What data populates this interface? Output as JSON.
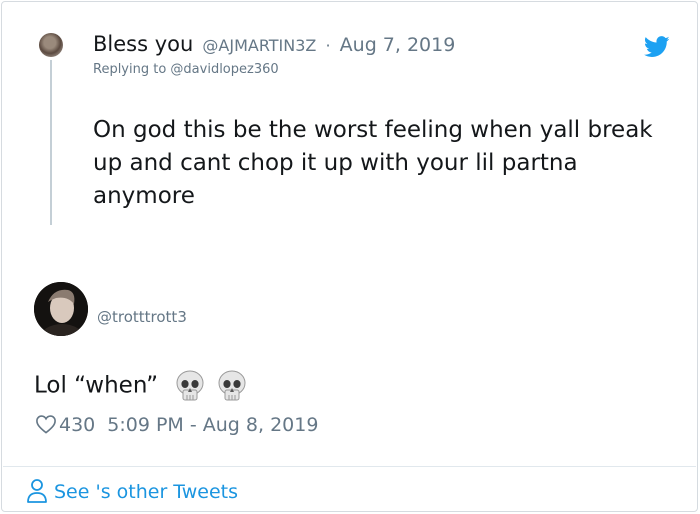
{
  "parent_tweet": {
    "display_name": "Bless you",
    "handle": "@AJMARTIN3Z",
    "date": "Aug 7, 2019",
    "replying_to": "Replying to @davidlopez360",
    "text": "On god this be the worst feeling when yall break up and cant chop it up with your lil partna anymore"
  },
  "main_tweet": {
    "handle": "@trotttrott3",
    "text": "Lol “when”",
    "emoji": "skull-emoji x2",
    "like_count": "430",
    "timestamp": "5:09 PM - Aug 8, 2019"
  },
  "footer": {
    "link_text": "See 's other Tweets",
    "icon": "user-outline-icon"
  },
  "colors": {
    "accent": "#1b95e0",
    "twitter_blue": "#1da1f2",
    "muted": "#657786",
    "text": "#14171a",
    "thread_line": "#c4cfd6"
  }
}
